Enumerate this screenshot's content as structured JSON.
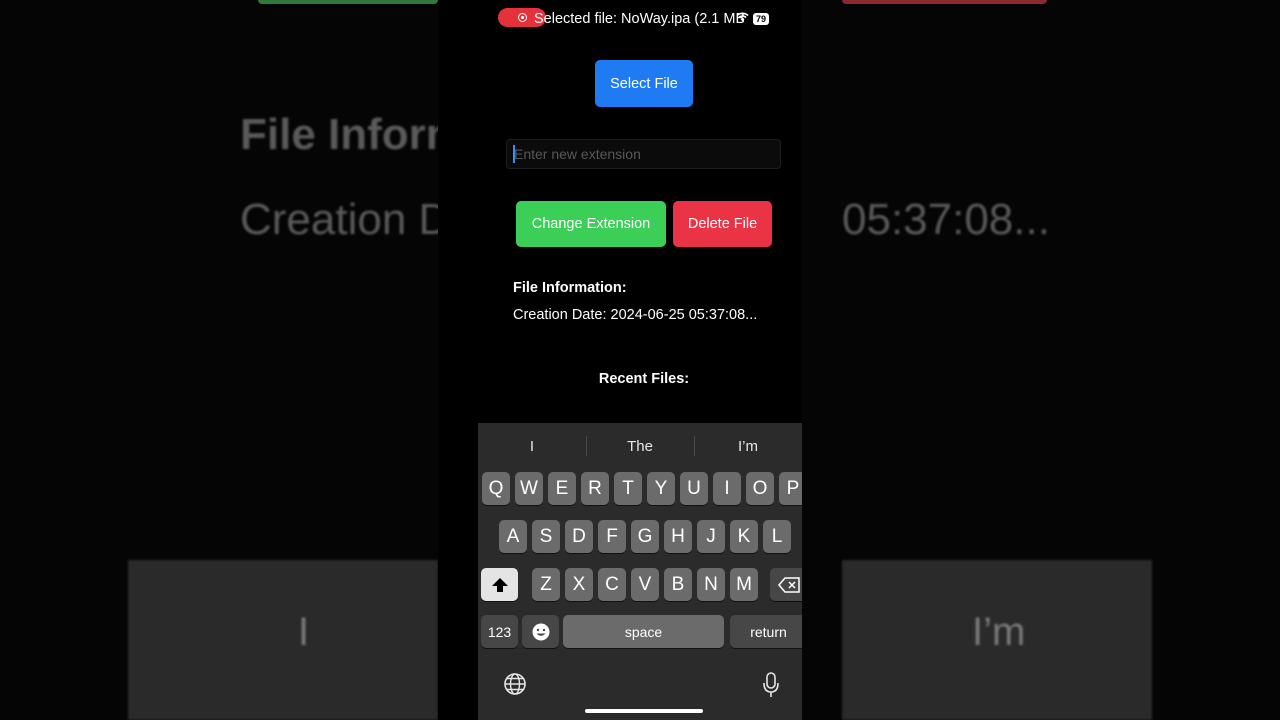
{
  "background": {
    "title": "File Inform",
    "date_left": "Creation D",
    "date_right": "05:37:08...",
    "kb_left": "I",
    "kb_right": "I’m"
  },
  "status_bar": {
    "selected_file": "Selected file: NoWay.ipa (2.1 MB)",
    "battery": "79",
    "wifi_icon": "wifi-icon",
    "recording_icon": "screen-recording-icon"
  },
  "app": {
    "select_file_label": "Select File",
    "extension_placeholder": "Enter new extension",
    "extension_value": "",
    "change_extension_label": "Change Extension",
    "delete_file_label": "Delete File",
    "file_info_title": "File Information:",
    "creation_date": "Creation Date: 2024-06-25 05:37:08...",
    "recent_files_title": "Recent Files:"
  },
  "colors": {
    "select_button": "#1f7bf3",
    "change_button": "#3ccf57",
    "delete_button": "#ea3344"
  },
  "keyboard": {
    "suggestions": [
      "I",
      "The",
      "I’m"
    ],
    "row1": [
      "Q",
      "W",
      "E",
      "R",
      "T",
      "Y",
      "U",
      "I",
      "O",
      "P"
    ],
    "row2": [
      "A",
      "S",
      "D",
      "F",
      "G",
      "H",
      "J",
      "K",
      "L"
    ],
    "row3": [
      "Z",
      "X",
      "C",
      "V",
      "B",
      "N",
      "M"
    ],
    "numbers_label": "123",
    "space_label": "space",
    "return_label": "return",
    "shift_icon": "shift-icon",
    "delete_icon": "backspace-icon",
    "emoji_icon": "emoji-icon",
    "globe_icon": "globe-icon",
    "mic_icon": "microphone-icon"
  }
}
